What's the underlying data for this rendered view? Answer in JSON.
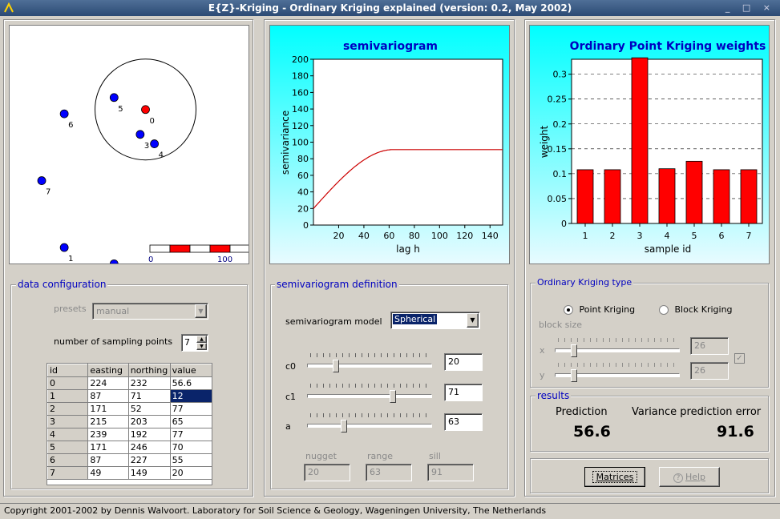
{
  "window": {
    "title": "E{Z}-Kriging - Ordinary Kriging explained (version: 0.2, May 2002)",
    "controls": "_ □ ×"
  },
  "map": {
    "points": [
      {
        "id": "0",
        "easting": 224,
        "northing": 232,
        "color": "#ff0000"
      },
      {
        "id": "1",
        "easting": 87,
        "northing": 71,
        "color": "#0000ff"
      },
      {
        "id": "2",
        "easting": 171,
        "northing": 52,
        "color": "#0000ff"
      },
      {
        "id": "3",
        "easting": 215,
        "northing": 203,
        "color": "#0000ff"
      },
      {
        "id": "4",
        "easting": 239,
        "northing": 192,
        "color": "#0000ff"
      },
      {
        "id": "5",
        "easting": 171,
        "northing": 246,
        "color": "#0000ff"
      },
      {
        "id": "6",
        "easting": 87,
        "northing": 227,
        "color": "#0000ff"
      },
      {
        "id": "7",
        "easting": 49,
        "northing": 149,
        "color": "#0000ff"
      }
    ],
    "search_radius": 63,
    "scalebar_start": "0",
    "scalebar_end": "100"
  },
  "semivariogram_chart": {
    "chart_data": {
      "type": "line",
      "title": "semivariogram",
      "xlabel": "lag h",
      "ylabel": "semivariance",
      "xlim": [
        0,
        150
      ],
      "ylim": [
        0,
        200
      ],
      "xticks": [
        "20",
        "40",
        "60",
        "80",
        "100",
        "120",
        "140"
      ],
      "yticks": [
        "0",
        "20",
        "40",
        "60",
        "80",
        "100",
        "120",
        "140",
        "160",
        "180",
        "200"
      ],
      "model": "spherical",
      "c0": 20,
      "c1": 71,
      "a": 63,
      "line_color": "#cc0000"
    }
  },
  "weights_chart": {
    "chart_data": {
      "type": "bar",
      "title": "Ordinary Point Kriging weights",
      "xlabel": "sample id",
      "ylabel": "weight",
      "categories": [
        "1",
        "2",
        "3",
        "4",
        "5",
        "6",
        "7"
      ],
      "values": [
        0.108,
        0.108,
        0.333,
        0.11,
        0.125,
        0.108,
        0.108
      ],
      "ylim": [
        0,
        0.33
      ],
      "yticks": [
        "0",
        "0.05",
        "0.1",
        "0.15",
        "0.2",
        "0.25",
        "0.3"
      ],
      "bar_color": "#ff0000",
      "grid": true
    }
  },
  "data_config": {
    "legend": "data configuration",
    "presets_label": "presets",
    "presets_value": "manual",
    "num_points_label": "number of sampling points",
    "num_points_value": "7",
    "headers": [
      "id",
      "easting",
      "northing",
      "value"
    ],
    "rows": [
      [
        "0",
        "224",
        "232",
        "56.6"
      ],
      [
        "1",
        "87",
        "71",
        "12"
      ],
      [
        "2",
        "171",
        "52",
        "77"
      ],
      [
        "3",
        "215",
        "203",
        "65"
      ],
      [
        "4",
        "239",
        "192",
        "77"
      ],
      [
        "5",
        "171",
        "246",
        "70"
      ],
      [
        "6",
        "87",
        "227",
        "55"
      ],
      [
        "7",
        "49",
        "149",
        "20"
      ]
    ]
  },
  "semivariogram_def": {
    "legend": "semivariogram definition",
    "model_label": "semivariogram model",
    "model_value": "Spherical",
    "c0_label": "c0",
    "c0_value": "20",
    "c0_level": 0.2,
    "c1_label": "c1",
    "c1_value": "71",
    "c1_level": 0.71,
    "a_label": "a",
    "a_value": "63",
    "a_level": 0.27,
    "nugget_label": "nugget",
    "nugget_value": "20",
    "range_label": "range",
    "range_value": "63",
    "sill_label": "sill",
    "sill_value": "91"
  },
  "kriging_type": {
    "legend": "Ordinary Kriging type",
    "point_label": "Point Kriging",
    "block_label": "Block Kriging",
    "block_size_label": "block size",
    "x_label": "x",
    "x_value": "26",
    "y_label": "y",
    "y_value": "26"
  },
  "results": {
    "legend": "results",
    "prediction_label": "Prediction",
    "prediction_value": "56.6",
    "variance_label": "Variance prediction error",
    "variance_value": "91.6"
  },
  "buttons": {
    "matrices": "Matrices",
    "help": "Help"
  },
  "status": "Copyright 2001-2002 by Dennis Walvoort. Laboratory for Soil Science & Geology, Wageningen University, The Netherlands"
}
